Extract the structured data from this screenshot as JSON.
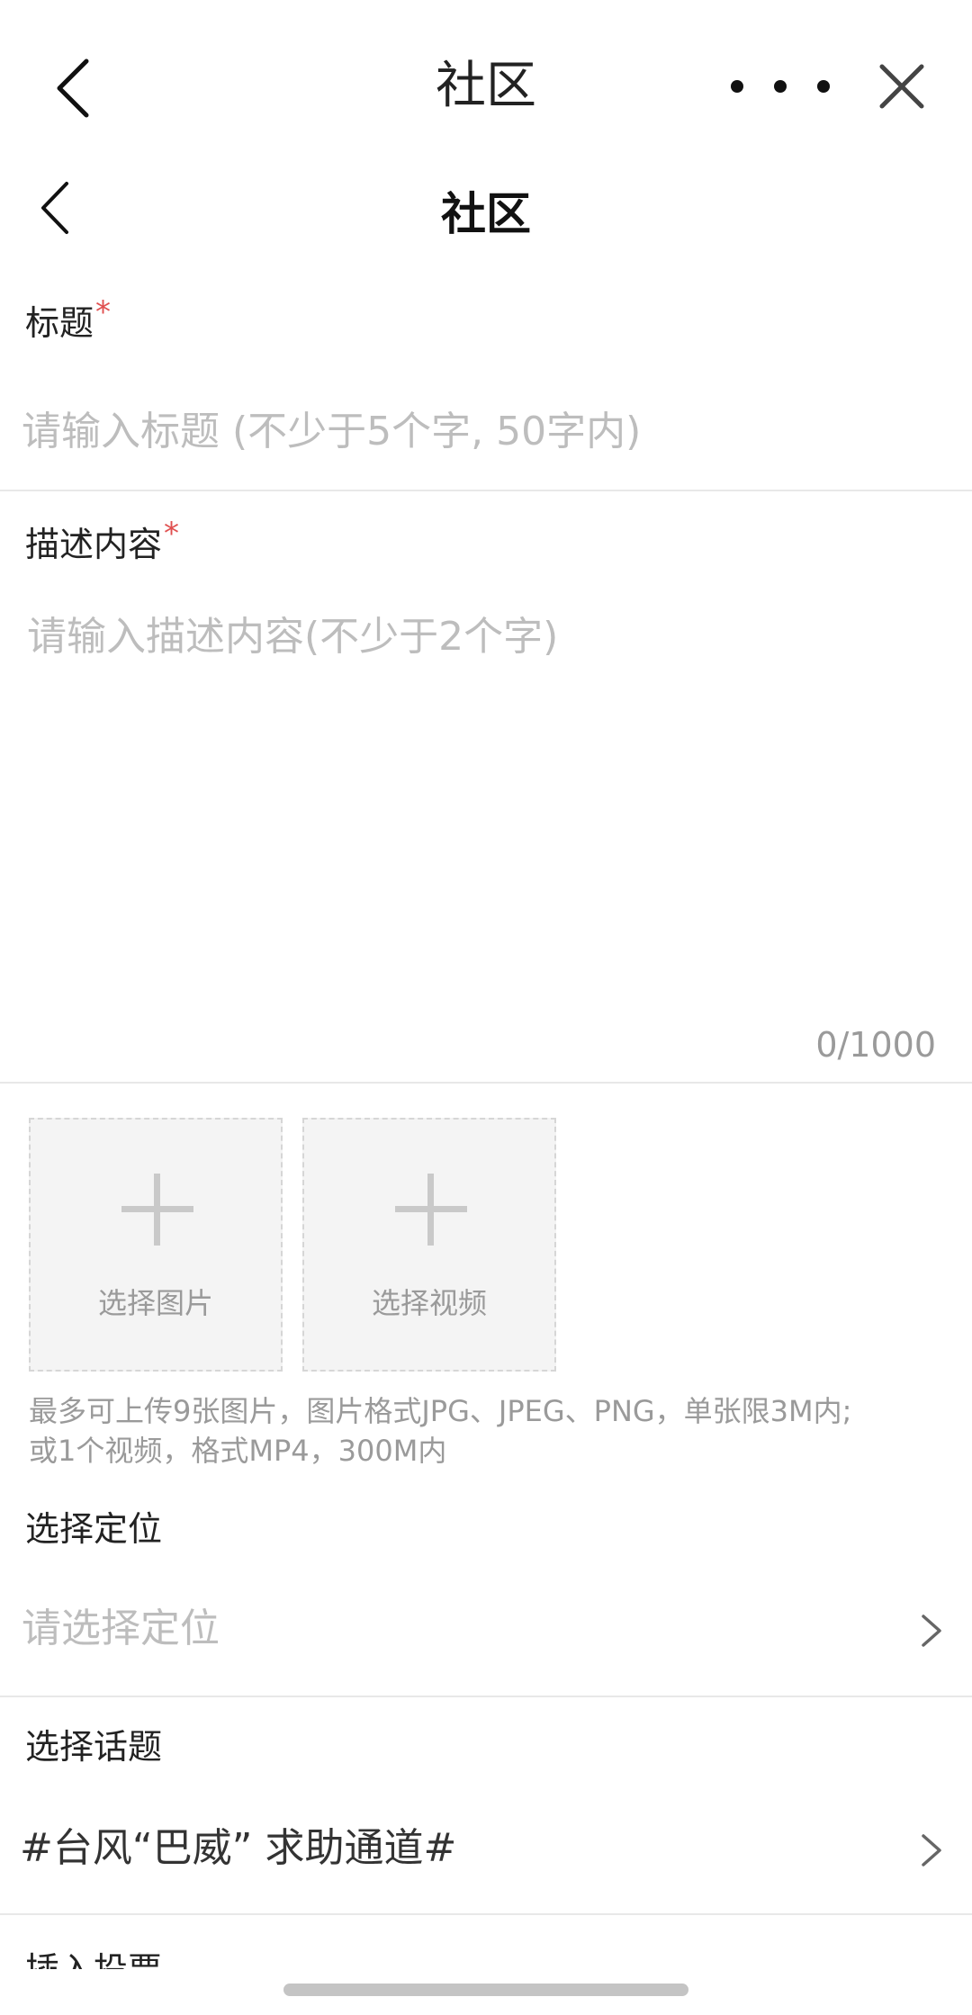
{
  "appbar": {
    "title": "社区"
  },
  "page_header": {
    "title": "社区"
  },
  "title_field": {
    "label": "标题",
    "required_mark": "*",
    "placeholder": "请输入标题 (不少于5个字, 50字内)"
  },
  "description_field": {
    "label": "描述内容",
    "required_mark": "*",
    "placeholder": "请输入描述内容(不少于2个字)",
    "counter": "0/1000"
  },
  "upload": {
    "image_label": "选择图片",
    "video_label": "选择视频",
    "hint_line1": "最多可上传9张图片，图片格式JPG、JPEG、PNG，单张限3M内;",
    "hint_line2": "或1个视频，格式MP4，300M内"
  },
  "location": {
    "label": "选择定位",
    "placeholder": "请选择定位"
  },
  "topic": {
    "label": "选择话题",
    "value": "#台风“巴威” 求助通道#"
  },
  "next_section": {
    "label": "插入投票"
  },
  "colors": {
    "required": "#e05050",
    "placeholder": "#bdbdbd",
    "hint": "#9a9a9a"
  }
}
